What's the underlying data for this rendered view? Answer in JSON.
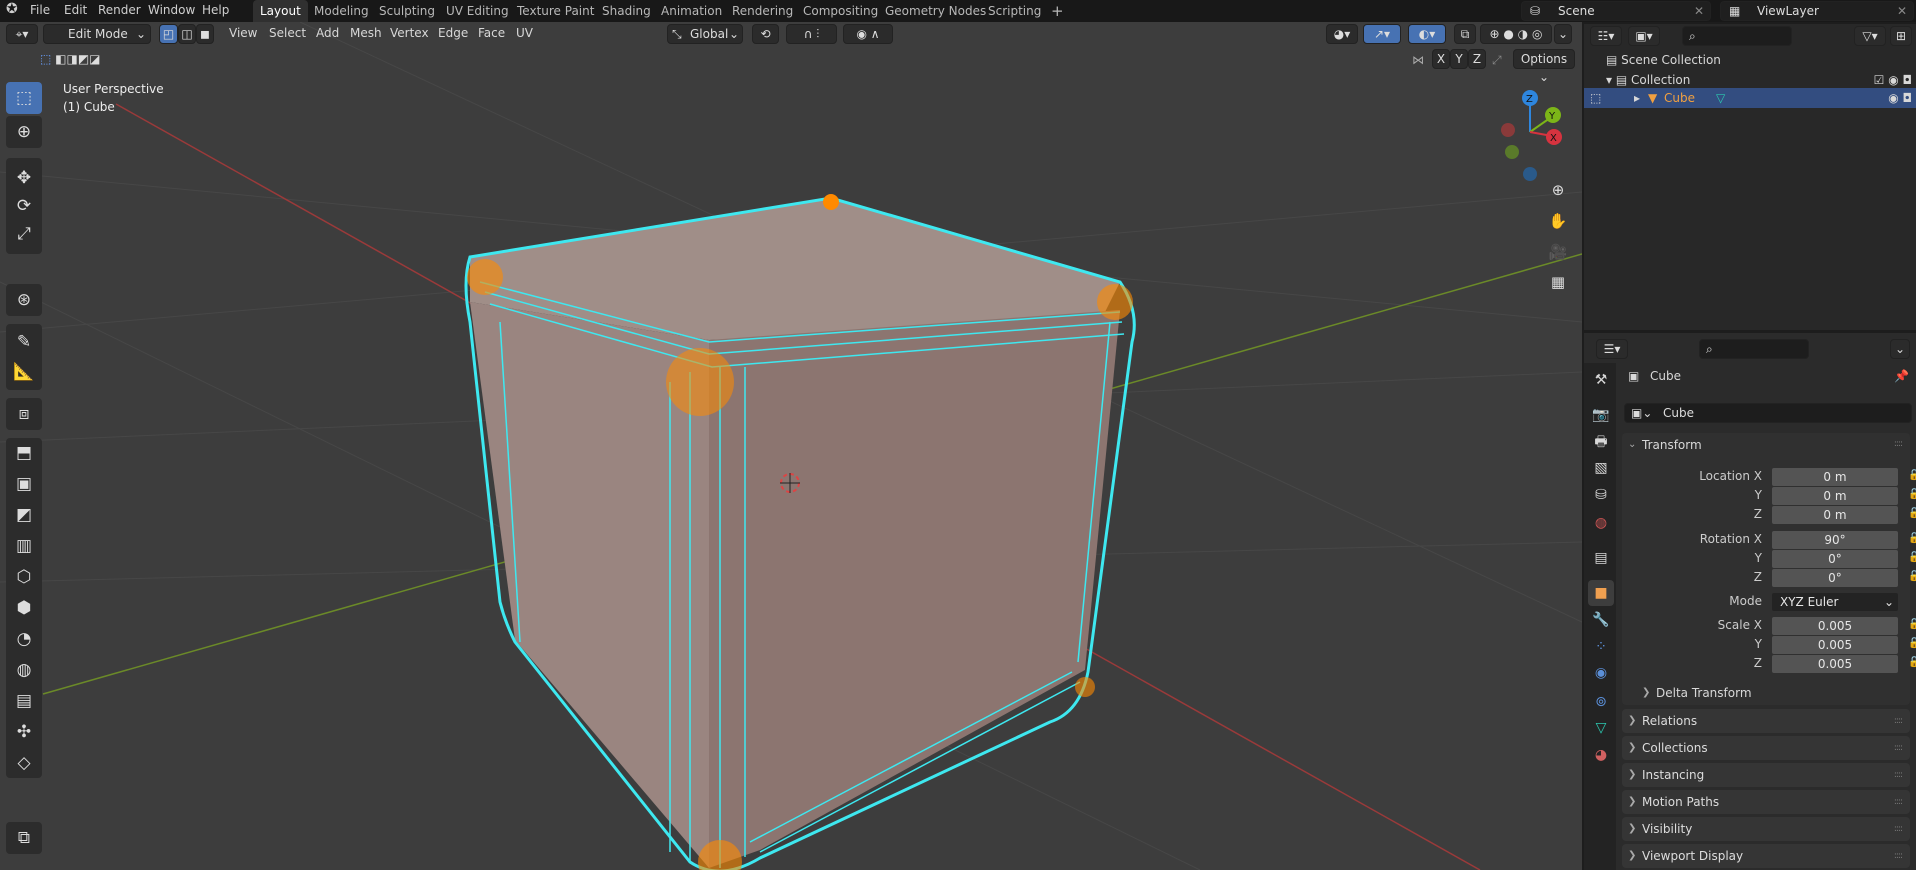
{
  "topbar": {
    "menus": [
      "File",
      "Edit",
      "Render",
      "Window",
      "Help"
    ],
    "workspaces": [
      "Layout",
      "Modeling",
      "Sculpting",
      "UV Editing",
      "Texture Paint",
      "Shading",
      "Animation",
      "Rendering",
      "Compositing",
      "Geometry Nodes",
      "Scripting"
    ],
    "active_workspace": "Layout",
    "add_workspace": "+",
    "scene": "Scene",
    "view_layer": "ViewLayer"
  },
  "viewport_header": {
    "mode": "Edit Mode",
    "menus": [
      "View",
      "Select",
      "Add",
      "Mesh",
      "Vertex",
      "Edge",
      "Face",
      "UV"
    ],
    "orientation": "Global",
    "axes": [
      "X",
      "Y",
      "Z"
    ],
    "options": "Options"
  },
  "viewport": {
    "perspective": "User Perspective",
    "object": "(1) Cube",
    "gizmo": {
      "z": "Z",
      "y": "Y",
      "x": "X"
    }
  },
  "colors": {
    "accent": "#4772b3",
    "edge": "#3ee8f0",
    "vertex": "#ff8a00",
    "x_axis": "#b34040",
    "y_axis": "#6e8a2a"
  },
  "outliner": {
    "items": [
      {
        "label": "Scene Collection"
      },
      {
        "label": "Collection"
      },
      {
        "label": "Cube",
        "selected": true
      }
    ]
  },
  "properties": {
    "object_name": "Cube",
    "name_field": "Cube",
    "transform": {
      "title": "Transform",
      "location_label": "Location X",
      "location": [
        "0 m",
        "0 m",
        "0 m"
      ],
      "rotation_label": "Rotation X",
      "rotation": [
        "90°",
        "0°",
        "0°"
      ],
      "mode_label": "Mode",
      "mode": "XYZ Euler",
      "scale_label": "Scale X",
      "scale": [
        "0.005",
        "0.005",
        "0.005"
      ],
      "y_label": "Y",
      "z_label": "Z",
      "delta": "Delta Transform"
    },
    "panels": [
      "Relations",
      "Collections",
      "Instancing",
      "Motion Paths",
      "Visibility",
      "Viewport Display"
    ]
  }
}
